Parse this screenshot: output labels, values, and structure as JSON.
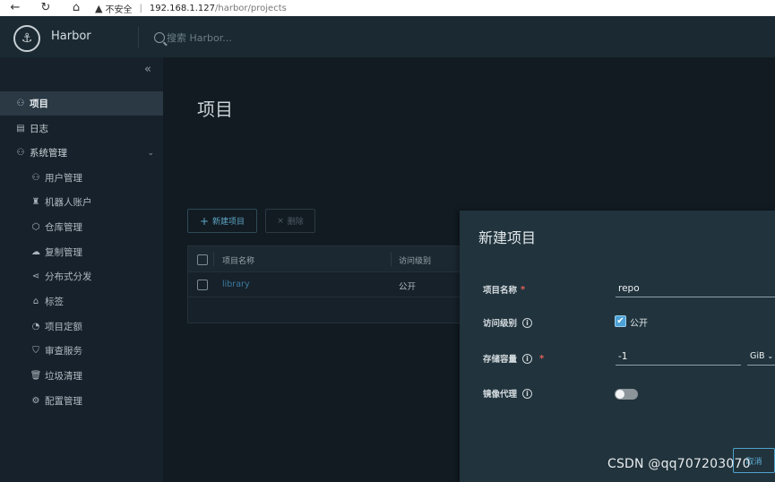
{
  "browser": {
    "back_icon": "←",
    "reload_icon": "↻",
    "home_icon": "⌂",
    "insecure_label": "不安全",
    "separator": "|",
    "url_host": "192.168.1.127",
    "url_path": "/harbor/projects"
  },
  "header": {
    "brand": "Harbor",
    "search_placeholder": "搜索 Harbor..."
  },
  "sidebar": {
    "collapse_icon": "«",
    "items": [
      {
        "label": "项目",
        "icon": "user-group-icon",
        "glyph": "⚇"
      },
      {
        "label": "日志",
        "icon": "document-icon",
        "glyph": "▤"
      },
      {
        "label": "系统管理",
        "icon": "users-cog-icon",
        "glyph": "⚇"
      }
    ],
    "admin_chevron": "⌄",
    "sub_items": [
      {
        "label": "用户管理",
        "icon": "users-icon",
        "glyph": "⚇"
      },
      {
        "label": "机器人账户",
        "icon": "robot-icon",
        "glyph": "♜"
      },
      {
        "label": "仓库管理",
        "icon": "cube-icon",
        "glyph": "⬡"
      },
      {
        "label": "复制管理",
        "icon": "cloud-icon",
        "glyph": "☁"
      },
      {
        "label": "分布式分发",
        "icon": "share-icon",
        "glyph": "⋖"
      },
      {
        "label": "标签",
        "icon": "tag-icon",
        "glyph": "⌂"
      },
      {
        "label": "项目定额",
        "icon": "gauge-icon",
        "glyph": "◔"
      },
      {
        "label": "审查服务",
        "icon": "shield-icon",
        "glyph": "⛉"
      },
      {
        "label": "垃圾清理",
        "icon": "trash-icon",
        "glyph": "🗑"
      },
      {
        "label": "配置管理",
        "icon": "gear-icon",
        "glyph": "⚙"
      }
    ]
  },
  "main": {
    "title": "项目",
    "new_project_button": "新建项目",
    "delete_button": "删除",
    "table": {
      "columns": [
        "项目名称",
        "访问级别"
      ],
      "rows": [
        {
          "name": "library",
          "access": "公开"
        }
      ]
    }
  },
  "modal": {
    "title": "新建项目",
    "fields": {
      "name_label": "项目名称",
      "name_value": "repo",
      "access_label": "访问级别",
      "public_label": "公开",
      "public_checked": true,
      "quota_label": "存储容量",
      "quota_value": "-1",
      "quota_unit": "GiB",
      "proxy_label": "镜像代理",
      "proxy_enabled": false
    },
    "required_mark": "*",
    "info_glyph": "i",
    "cancel_button": "取消"
  },
  "watermark": "CSDN @qq707203070",
  "colors": {
    "header_bg": "#1b2a32",
    "sidebar_bg": "#17212b",
    "main_bg": "#121b22",
    "modal_bg": "#21333c",
    "accent": "#4ca1d6",
    "required": "#e0605a"
  }
}
